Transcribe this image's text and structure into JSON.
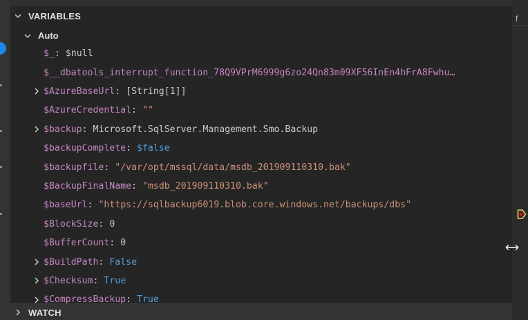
{
  "panel": {
    "variables_title": "VARIABLES",
    "watch_title": "WATCH",
    "scope_label": "Auto"
  },
  "edge": {
    "tab_char": "f"
  },
  "colors": {
    "name": "#c586c0",
    "string": "#ce9178",
    "keyword": "#569cd6",
    "number": "#b5cea8",
    "text": "#cccccc",
    "accent": "#1e88e5",
    "breakpoint": "#f2c94c"
  },
  "variables": [
    {
      "name": "$_",
      "value": "$null",
      "type": "plain",
      "expandable": false
    },
    {
      "name": "$__dbatools_interrupt_function_78Q9VPrM6999g6zo24Qn83m09XF56InEn4hFrA8Fwhu…",
      "value": "",
      "type": "plain",
      "expandable": false
    },
    {
      "name": "$AzureBaseUrl",
      "value": "[String[1]]",
      "type": "plain",
      "expandable": true
    },
    {
      "name": "$AzureCredential",
      "value": "\"\"",
      "type": "string",
      "expandable": false
    },
    {
      "name": "$backup",
      "value": "Microsoft.SqlServer.Management.Smo.Backup",
      "type": "plain",
      "expandable": true
    },
    {
      "name": "$backupComplete",
      "value": "$false",
      "type": "keyword",
      "expandable": false
    },
    {
      "name": "$backupfile",
      "value": "\"/var/opt/mssql/data/msdb_201909110310.bak\"",
      "type": "string",
      "expandable": false
    },
    {
      "name": "$BackupFinalName",
      "value": "\"msdb_201909110310.bak\"",
      "type": "string",
      "expandable": false
    },
    {
      "name": "$baseUrl",
      "value": "\"https://sqlbackup6019.blob.core.windows.net/backups/dbs\"",
      "type": "string",
      "expandable": false
    },
    {
      "name": "$BlockSize",
      "value": "0",
      "type": "number",
      "expandable": false
    },
    {
      "name": "$BufferCount",
      "value": "0",
      "type": "number",
      "expandable": false
    },
    {
      "name": "$BuildPath",
      "value": "False",
      "type": "keyword",
      "expandable": true
    },
    {
      "name": "$Checksum",
      "value": "True",
      "type": "keyword",
      "expandable": true
    },
    {
      "name": "$CompressBackup",
      "value": "True",
      "type": "keyword",
      "expandable": true
    }
  ]
}
